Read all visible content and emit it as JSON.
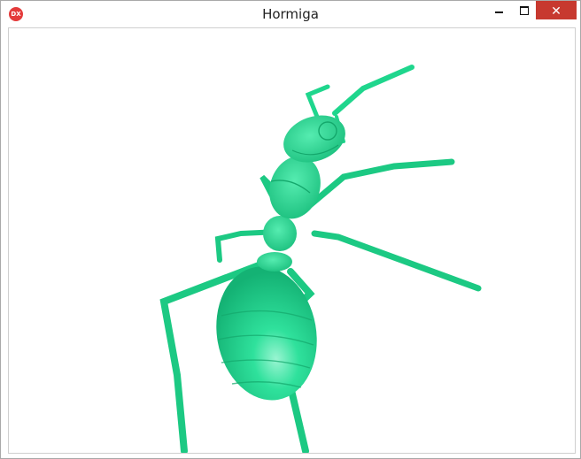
{
  "window": {
    "title": "Hormiga",
    "app_icon_text": "DX",
    "controls": {
      "minimize_icon": "minimize-icon",
      "maximize_icon": "maximize-icon",
      "close_icon": "close-icon",
      "close_glyph": "✕"
    }
  },
  "scene": {
    "subject": "ant-model",
    "colors": {
      "body": "#1fd68d",
      "body_dark": "#14a86c",
      "highlight": "#8ff0c8",
      "background": "#ffffff",
      "close_button": "#c7392f"
    }
  }
}
